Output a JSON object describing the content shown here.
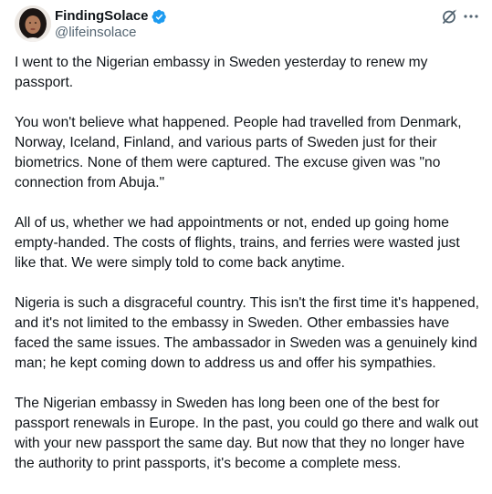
{
  "author": {
    "display_name": "FindingSolace",
    "handle": "@lifeinsolace",
    "verified": true,
    "accent_color": "#1d9bf0"
  },
  "icons": {
    "verified": "verified-badge-icon",
    "grok": "grok-icon",
    "more": "more-options-icon"
  },
  "post": {
    "paragraphs": [
      "I went to the Nigerian embassy in Sweden yesterday to renew my passport.",
      "You won't believe what happened. People had travelled from Denmark, Norway, Iceland, Finland, and various parts of Sweden just for their biometrics. None of them were captured. The excuse given was \"no connection from Abuja.\"",
      "All of us, whether we had appointments or not, ended up going home empty-handed. The costs of flights, trains, and ferries were wasted just like that. We were simply told to come back anytime.",
      "Nigeria is such a disgraceful country. This isn't the first time it's happened, and it's not limited to the embassy in Sweden. Other embassies have faced the same issues. The ambassador in Sweden was a genuinely kind man; he kept coming down to address us and offer his sympathies.",
      "The Nigerian embassy in Sweden has long been one of the best for passport renewals in Europe. In the past, you could go there and walk out with your new passport the same day. But now that they no longer have the authority to print passports, it's become a complete mess."
    ]
  }
}
